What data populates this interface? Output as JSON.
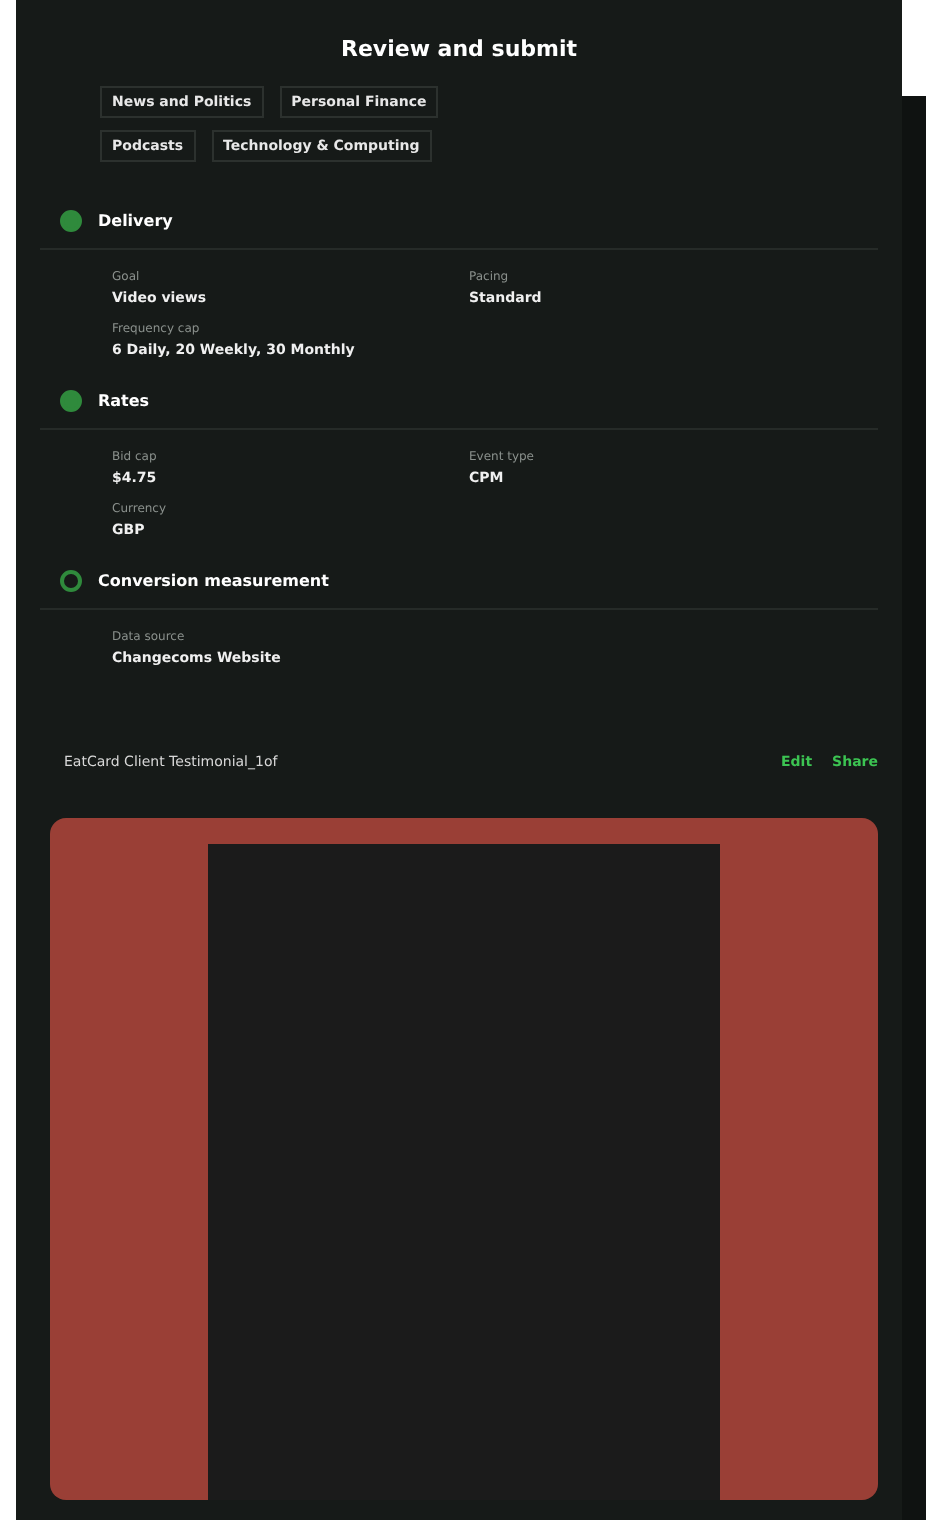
{
  "header": {
    "title": "Review and submit"
  },
  "tags": [
    "News and Politics",
    "Personal Finance",
    "Podcasts",
    "Technology & Computing"
  ],
  "sections": [
    {
      "title": "Delivery",
      "complete": true,
      "fields": [
        {
          "label": "Goal",
          "value": "Video views"
        },
        {
          "label": "Pacing",
          "value": "Standard"
        },
        {
          "label": "Frequency cap",
          "value": "6 Daily, 20 Weekly, 30 Monthly"
        }
      ]
    },
    {
      "title": "Rates",
      "complete": true,
      "fields": [
        {
          "label": "Bid cap",
          "value": "$4.75"
        },
        {
          "label": "Event type",
          "value": "CPM"
        },
        {
          "label": "Currency",
          "value": "GBP"
        }
      ]
    },
    {
      "title": "Conversion measurement",
      "complete": false,
      "fields": [
        {
          "label": "Data source",
          "value": "Changecoms Website"
        }
      ]
    }
  ],
  "creative": {
    "name": "EatCard Client Testimonial_1of",
    "actions": [
      "Edit",
      "Share"
    ]
  }
}
